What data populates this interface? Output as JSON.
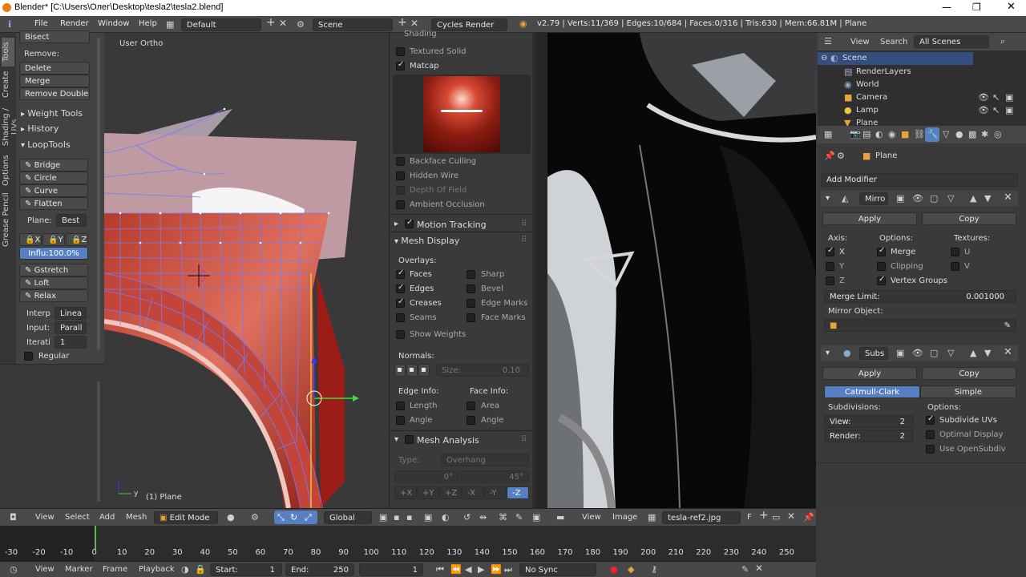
{
  "titlebar": {
    "title": "Blender* [C:\\Users\\Олег\\Desktop\\tesla2\\tesla2.blend]"
  },
  "info": {
    "menus": [
      "File",
      "Render",
      "Window",
      "Help"
    ],
    "layout": "Default",
    "scene": "Scene",
    "engine": "Cycles Render",
    "stats": "v2.79 | Verts:11/369 | Edges:10/684 | Faces:0/316 | Tris:630 | Mem:66.81M | Plane"
  },
  "toolshelf": {
    "tabs": [
      "Tools",
      "Create",
      "Shading / UVs",
      "Options",
      "Grease Pencil"
    ],
    "bisect": "Bisect",
    "remove_label": "Remove:",
    "delete": "Delete",
    "merge": "Merge",
    "remove_doubles": "Remove Doubles",
    "weight_tools": "Weight Tools",
    "history": "History",
    "looptools": "LoopTools",
    "bridge": "Bridge",
    "circle": "Circle",
    "curve": "Curve",
    "flatten": "Flatten",
    "plane_label": "Plane:",
    "plane_value": "Best",
    "axis_x": "X",
    "axis_y": "Y",
    "axis_z": "Z",
    "influ": "Influ:100.0%",
    "gstretch": "Gstretch",
    "loft": "Loft",
    "relax": "Relax",
    "interp_label": "Interp",
    "interp_value": "Linea",
    "input_label": "Input:",
    "input_value": "Parall",
    "iterati_label": "Iterati",
    "iterati_value": "1",
    "regular": "Regular"
  },
  "viewport": {
    "view_name": "User Ortho",
    "object_label": "(1) Plane"
  },
  "props": {
    "shading": "Shading",
    "textured_solid": "Textured Solid",
    "matcap": "Matcap",
    "backface_culling": "Backface Culling",
    "hidden_wire": "Hidden Wire",
    "depth_of_field": "Depth Of Field",
    "ambient_occlusion": "Ambient Occlusion",
    "motion_tracking": "Motion Tracking",
    "mesh_display": "Mesh Display",
    "overlays": "Overlays:",
    "faces": "Faces",
    "sharp": "Sharp",
    "edges": "Edges",
    "bevel": "Bevel",
    "creases": "Creases",
    "edge_marks": "Edge Marks",
    "seams": "Seams",
    "face_marks": "Face Marks",
    "show_weights": "Show Weights",
    "normals": "Normals:",
    "size": "Size:",
    "size_value": "0.10",
    "edge_info": "Edge Info:",
    "face_info": "Face Info:",
    "length": "Length",
    "area": "Area",
    "angle_e": "Angle",
    "angle_f": "Angle",
    "mesh_analysis": "Mesh Analysis",
    "type_label": "Type:",
    "type_value": "Overhang",
    "deg0": "0°",
    "deg45": "45°",
    "axes": [
      "+X",
      "+Y",
      "+Z",
      "-X",
      "-Y",
      "-Z"
    ]
  },
  "outliner": {
    "view": "View",
    "search": "Search",
    "filter": "All Scenes",
    "items": [
      "Scene",
      "RenderLayers",
      "World",
      "Camera",
      "Lamp",
      "Plane"
    ]
  },
  "modifiers": {
    "object": "Plane",
    "add_modifier": "Add Modifier",
    "mirror_name": "Mirro",
    "apply": "Apply",
    "copy": "Copy",
    "axis": "Axis:",
    "options": "Options:",
    "textures": "Textures:",
    "x": "X",
    "y": "Y",
    "z": "Z",
    "merge": "Merge",
    "clipping": "Clipping",
    "vertex_groups": "Vertex Groups",
    "u": "U",
    "v": "V",
    "merge_limit": "Merge Limit:",
    "merge_limit_value": "0.001000",
    "mirror_object": "Mirror Object:",
    "subs_name": "Subs",
    "catmull": "Catmull-Clark",
    "simple": "Simple",
    "subdivisions": "Subdivisions:",
    "view": "View:",
    "view_value": "2",
    "render": "Render:",
    "render_value": "2",
    "subdivide_uvs": "Subdivide UVs",
    "optimal_display": "Optimal Display",
    "use_opensubdiv": "Use OpenSubdiv"
  },
  "header3d": {
    "menus": [
      "View",
      "Select",
      "Add",
      "Mesh"
    ],
    "mode": "Edit Mode",
    "orientation": "Global",
    "img_menus": [
      "View",
      "Image"
    ],
    "image_name": "tesla-ref2.jpg",
    "f": "F"
  },
  "timeline": {
    "ticks": [
      "-30",
      "-20",
      "-10",
      "0",
      "10",
      "20",
      "30",
      "40",
      "50",
      "60",
      "70",
      "80",
      "90",
      "100",
      "110",
      "120",
      "130",
      "140",
      "150",
      "160",
      "170",
      "180",
      "190",
      "200",
      "210",
      "220",
      "230",
      "240",
      "250"
    ],
    "menus": [
      "View",
      "Marker",
      "Frame",
      "Playback"
    ],
    "start_label": "Start:",
    "start_value": "1",
    "end_label": "End:",
    "end_value": "250",
    "current": "1",
    "sync": "No Sync"
  },
  "colors": {
    "accent": "#5680c2",
    "mesh_red": "#b8352a",
    "wire": "#6f7dff"
  }
}
